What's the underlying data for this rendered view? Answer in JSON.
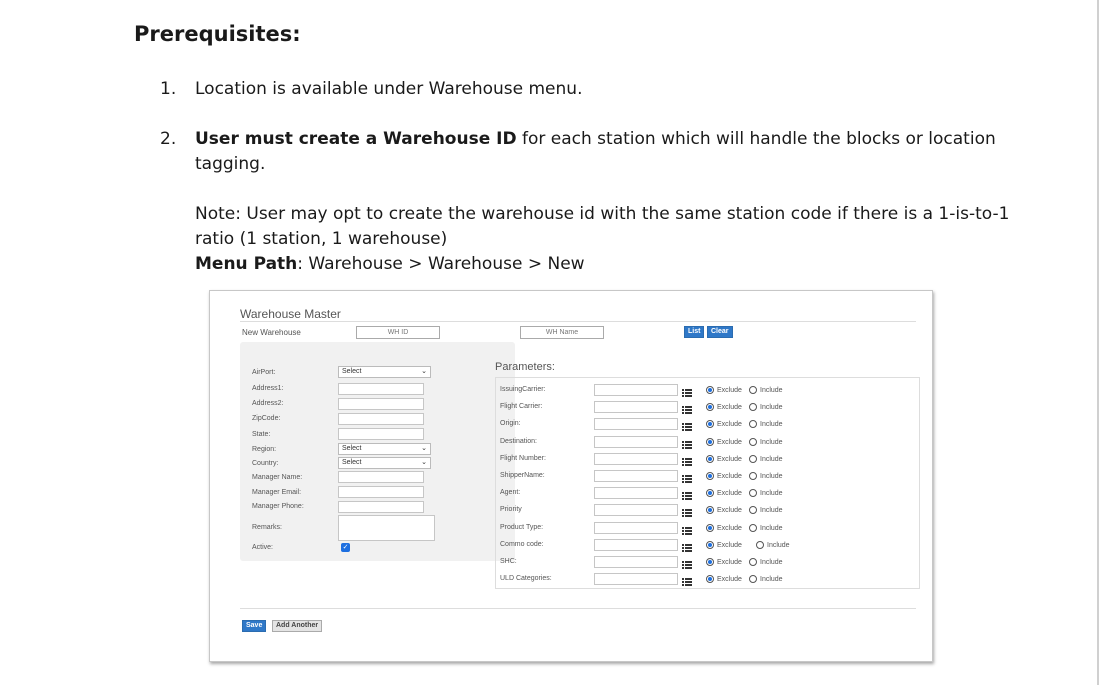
{
  "doc": {
    "heading": "Prerequisites:",
    "items": [
      {
        "num": "1.",
        "text": "Location is available under Warehouse menu."
      },
      {
        "num": "2.",
        "bold": "User must create a Warehouse ID",
        "rest1": " for each station which will handle the blocks or location",
        "rest2": "tagging."
      }
    ],
    "note_line1": "Note: User may opt to create the warehouse id with the same station code if there is a 1-is-to-1",
    "note_line2": "ratio (1 station, 1 warehouse)",
    "menu_path_label": "Menu Path",
    "menu_path_value": ": Warehouse > Warehouse > New"
  },
  "screen": {
    "title": "Warehouse Master",
    "new_warehouse_label": "New Warehouse",
    "wh_id_placeholder": "WH ID",
    "wh_name_placeholder": "WH Name",
    "list_button": "List",
    "clear_button": "Clear",
    "fields": {
      "airport": "AirPort:",
      "address1": "Address1:",
      "address2": "Address2:",
      "zipcode": "ZipCode:",
      "state": "State:",
      "region": "Region:",
      "country": "Country:",
      "manager_name": "Manager Name:",
      "manager_email": "Manager Email:",
      "manager_phone": "Manager Phone:",
      "remarks": "Remarks:",
      "active": "Active:"
    },
    "select_value": "Select",
    "parameters_title": "Parameters:",
    "parameters": [
      "IssuingCarrier:",
      "Flight Carrier:",
      "Origin:",
      "Destination:",
      "Flight Number:",
      "ShipperName:",
      "Agent:",
      "Priority",
      "Product Type:",
      "Commo code:",
      "SHC:",
      "ULD Categories:"
    ],
    "exclude_label": "Exclude",
    "include_label": "Include",
    "save_button": "Save",
    "add_another_button": "Add Another"
  }
}
